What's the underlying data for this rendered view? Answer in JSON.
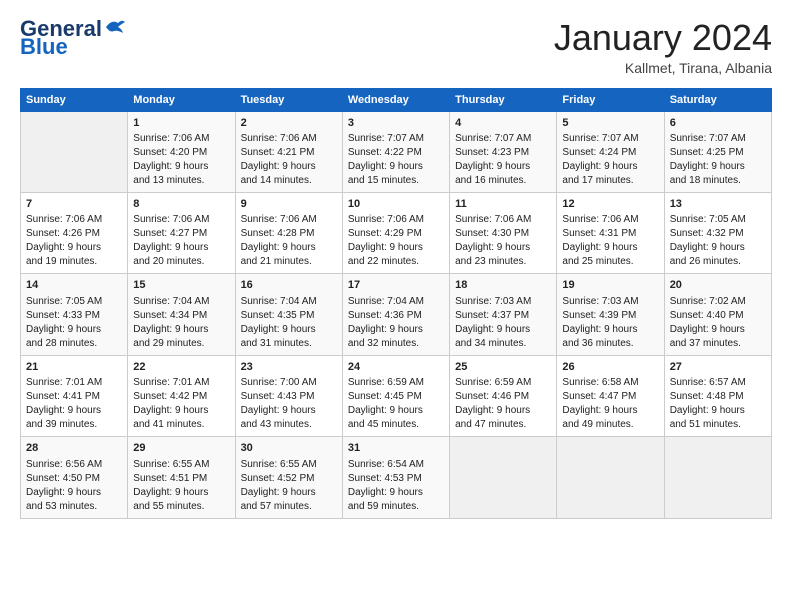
{
  "logo": {
    "line1": "General",
    "line2": "Blue"
  },
  "title": "January 2024",
  "subtitle": "Kallmet, Tirana, Albania",
  "days_header": [
    "Sunday",
    "Monday",
    "Tuesday",
    "Wednesday",
    "Thursday",
    "Friday",
    "Saturday"
  ],
  "weeks": [
    [
      {
        "day": "",
        "info": ""
      },
      {
        "day": "1",
        "info": "Sunrise: 7:06 AM\nSunset: 4:20 PM\nDaylight: 9 hours\nand 13 minutes."
      },
      {
        "day": "2",
        "info": "Sunrise: 7:06 AM\nSunset: 4:21 PM\nDaylight: 9 hours\nand 14 minutes."
      },
      {
        "day": "3",
        "info": "Sunrise: 7:07 AM\nSunset: 4:22 PM\nDaylight: 9 hours\nand 15 minutes."
      },
      {
        "day": "4",
        "info": "Sunrise: 7:07 AM\nSunset: 4:23 PM\nDaylight: 9 hours\nand 16 minutes."
      },
      {
        "day": "5",
        "info": "Sunrise: 7:07 AM\nSunset: 4:24 PM\nDaylight: 9 hours\nand 17 minutes."
      },
      {
        "day": "6",
        "info": "Sunrise: 7:07 AM\nSunset: 4:25 PM\nDaylight: 9 hours\nand 18 minutes."
      }
    ],
    [
      {
        "day": "7",
        "info": "Sunrise: 7:06 AM\nSunset: 4:26 PM\nDaylight: 9 hours\nand 19 minutes."
      },
      {
        "day": "8",
        "info": "Sunrise: 7:06 AM\nSunset: 4:27 PM\nDaylight: 9 hours\nand 20 minutes."
      },
      {
        "day": "9",
        "info": "Sunrise: 7:06 AM\nSunset: 4:28 PM\nDaylight: 9 hours\nand 21 minutes."
      },
      {
        "day": "10",
        "info": "Sunrise: 7:06 AM\nSunset: 4:29 PM\nDaylight: 9 hours\nand 22 minutes."
      },
      {
        "day": "11",
        "info": "Sunrise: 7:06 AM\nSunset: 4:30 PM\nDaylight: 9 hours\nand 23 minutes."
      },
      {
        "day": "12",
        "info": "Sunrise: 7:06 AM\nSunset: 4:31 PM\nDaylight: 9 hours\nand 25 minutes."
      },
      {
        "day": "13",
        "info": "Sunrise: 7:05 AM\nSunset: 4:32 PM\nDaylight: 9 hours\nand 26 minutes."
      }
    ],
    [
      {
        "day": "14",
        "info": "Sunrise: 7:05 AM\nSunset: 4:33 PM\nDaylight: 9 hours\nand 28 minutes."
      },
      {
        "day": "15",
        "info": "Sunrise: 7:04 AM\nSunset: 4:34 PM\nDaylight: 9 hours\nand 29 minutes."
      },
      {
        "day": "16",
        "info": "Sunrise: 7:04 AM\nSunset: 4:35 PM\nDaylight: 9 hours\nand 31 minutes."
      },
      {
        "day": "17",
        "info": "Sunrise: 7:04 AM\nSunset: 4:36 PM\nDaylight: 9 hours\nand 32 minutes."
      },
      {
        "day": "18",
        "info": "Sunrise: 7:03 AM\nSunset: 4:37 PM\nDaylight: 9 hours\nand 34 minutes."
      },
      {
        "day": "19",
        "info": "Sunrise: 7:03 AM\nSunset: 4:39 PM\nDaylight: 9 hours\nand 36 minutes."
      },
      {
        "day": "20",
        "info": "Sunrise: 7:02 AM\nSunset: 4:40 PM\nDaylight: 9 hours\nand 37 minutes."
      }
    ],
    [
      {
        "day": "21",
        "info": "Sunrise: 7:01 AM\nSunset: 4:41 PM\nDaylight: 9 hours\nand 39 minutes."
      },
      {
        "day": "22",
        "info": "Sunrise: 7:01 AM\nSunset: 4:42 PM\nDaylight: 9 hours\nand 41 minutes."
      },
      {
        "day": "23",
        "info": "Sunrise: 7:00 AM\nSunset: 4:43 PM\nDaylight: 9 hours\nand 43 minutes."
      },
      {
        "day": "24",
        "info": "Sunrise: 6:59 AM\nSunset: 4:45 PM\nDaylight: 9 hours\nand 45 minutes."
      },
      {
        "day": "25",
        "info": "Sunrise: 6:59 AM\nSunset: 4:46 PM\nDaylight: 9 hours\nand 47 minutes."
      },
      {
        "day": "26",
        "info": "Sunrise: 6:58 AM\nSunset: 4:47 PM\nDaylight: 9 hours\nand 49 minutes."
      },
      {
        "day": "27",
        "info": "Sunrise: 6:57 AM\nSunset: 4:48 PM\nDaylight: 9 hours\nand 51 minutes."
      }
    ],
    [
      {
        "day": "28",
        "info": "Sunrise: 6:56 AM\nSunset: 4:50 PM\nDaylight: 9 hours\nand 53 minutes."
      },
      {
        "day": "29",
        "info": "Sunrise: 6:55 AM\nSunset: 4:51 PM\nDaylight: 9 hours\nand 55 minutes."
      },
      {
        "day": "30",
        "info": "Sunrise: 6:55 AM\nSunset: 4:52 PM\nDaylight: 9 hours\nand 57 minutes."
      },
      {
        "day": "31",
        "info": "Sunrise: 6:54 AM\nSunset: 4:53 PM\nDaylight: 9 hours\nand 59 minutes."
      },
      {
        "day": "",
        "info": ""
      },
      {
        "day": "",
        "info": ""
      },
      {
        "day": "",
        "info": ""
      }
    ]
  ]
}
